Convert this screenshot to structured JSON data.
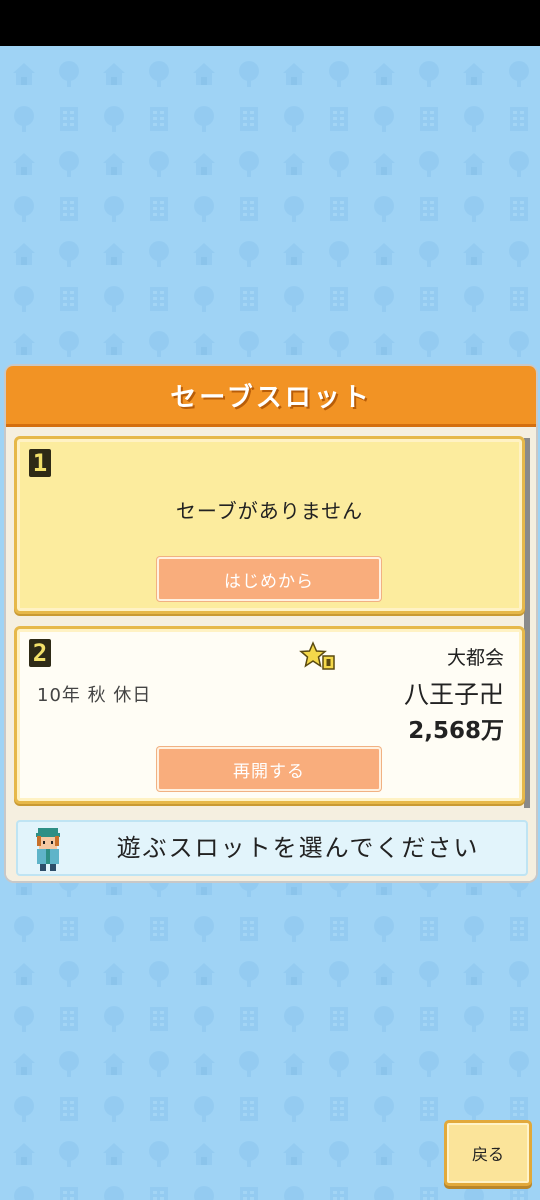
{
  "dialog": {
    "title": "セーブスロット"
  },
  "slots": [
    {
      "number": "1",
      "empty_text": "セーブがありません",
      "button_label": "はじめから"
    },
    {
      "number": "2",
      "rank": "大都会",
      "date": "10年 秋 休日",
      "city_name": "八王子卍",
      "money": "2,568万",
      "button_label": "再開する",
      "badge_icon": "star-badge-icon"
    }
  ],
  "message": {
    "text": "遊ぶスロットを選んでください",
    "avatar_icon": "guide-character-icon"
  },
  "back_button": {
    "label": "戻る"
  },
  "colors": {
    "background": "#9fd3f5",
    "header": "#f29324",
    "slot_empty_bg": "#fcec9e",
    "slot_saved_bg": "#fffdf5",
    "slot_button": "#f9ad7c"
  }
}
